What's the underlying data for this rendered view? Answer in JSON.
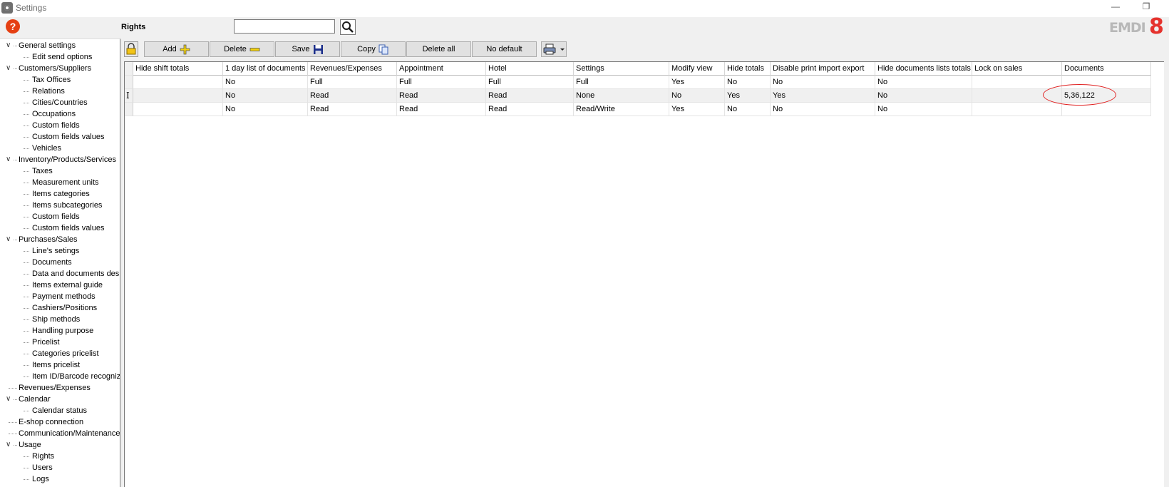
{
  "window": {
    "title": "Settings",
    "minimize": "—",
    "restore": "❐"
  },
  "header": {
    "title": "Rights",
    "search_placeholder": "",
    "logo_text": "EMDI",
    "logo_number": "8"
  },
  "toolbar": {
    "add_label": "Add",
    "delete_label": "Delete",
    "save_label": "Save",
    "copy_label": "Copy",
    "delete_all_label": "Delete all",
    "no_default_label": "No default"
  },
  "sidebar": {
    "items": [
      {
        "label": "General settings",
        "level": 0,
        "expanded": true
      },
      {
        "label": "Edit send options",
        "level": 1
      },
      {
        "label": "Customers/Suppliers",
        "level": 0,
        "expanded": true
      },
      {
        "label": "Tax Offices",
        "level": 1
      },
      {
        "label": "Relations",
        "level": 1
      },
      {
        "label": "Cities/Countries",
        "level": 1
      },
      {
        "label": "Occupations",
        "level": 1
      },
      {
        "label": "Custom fields",
        "level": 1
      },
      {
        "label": "Custom fields values",
        "level": 1
      },
      {
        "label": "Vehicles",
        "level": 1
      },
      {
        "label": "Inventory/Products/Services",
        "level": 0,
        "expanded": true
      },
      {
        "label": "Taxes",
        "level": 1
      },
      {
        "label": "Measurement units",
        "level": 1
      },
      {
        "label": "Items categories",
        "level": 1
      },
      {
        "label": "Items subcategories",
        "level": 1
      },
      {
        "label": "Custom fields",
        "level": 1
      },
      {
        "label": "Custom fields values",
        "level": 1
      },
      {
        "label": "Purchases/Sales",
        "level": 0,
        "expanded": true
      },
      {
        "label": "Line's setings",
        "level": 1
      },
      {
        "label": "Documents",
        "level": 1
      },
      {
        "label": "Data and documents desi",
        "level": 1
      },
      {
        "label": "Items external guide",
        "level": 1
      },
      {
        "label": "Payment methods",
        "level": 1
      },
      {
        "label": "Cashiers/Positions",
        "level": 1
      },
      {
        "label": "Ship methods",
        "level": 1
      },
      {
        "label": "Handling purpose",
        "level": 1
      },
      {
        "label": "Pricelist",
        "level": 1
      },
      {
        "label": "Categories pricelist",
        "level": 1
      },
      {
        "label": "Items pricelist",
        "level": 1
      },
      {
        "label": "Item ID/Barcode recognize",
        "level": 1
      },
      {
        "label": "Revenues/Expenses",
        "level": 0
      },
      {
        "label": "Calendar",
        "level": 0,
        "expanded": true
      },
      {
        "label": "Calendar status",
        "level": 1
      },
      {
        "label": "E-shop connection",
        "level": 0
      },
      {
        "label": "Communication/Maintenance",
        "level": 0
      },
      {
        "label": "Usage",
        "level": 0,
        "expanded": true
      },
      {
        "label": "Rights",
        "level": 1
      },
      {
        "label": "Users",
        "level": 1
      },
      {
        "label": "Logs",
        "level": 1
      }
    ]
  },
  "grid": {
    "columns": [
      "Hide shift totals",
      "1 day list of documents",
      "Revenues/Expenses",
      "Appointment",
      "Hotel",
      "Settings",
      "Modify view",
      "Hide totals",
      "Disable print import export",
      "Hide documents lists totals",
      "Lock on sales",
      "Documents"
    ],
    "rows": [
      [
        "",
        "No",
        "Full",
        "Full",
        "Full",
        "Full",
        "Yes",
        "No",
        "No",
        "No",
        "",
        ""
      ],
      [
        "",
        "No",
        "Read",
        "Read",
        "Read",
        "None",
        "No",
        "Yes",
        "Yes",
        "No",
        "",
        "5,36,122"
      ],
      [
        "",
        "No",
        "Read",
        "Read",
        "Read",
        "Read/Write",
        "Yes",
        "No",
        "No",
        "No",
        "",
        ""
      ]
    ],
    "selected_row": 1,
    "cursor_glyph": "I"
  },
  "colors": {
    "accent_red": "#e53f12",
    "logo_red": "#e5322d",
    "ellipse": "#e02020"
  }
}
